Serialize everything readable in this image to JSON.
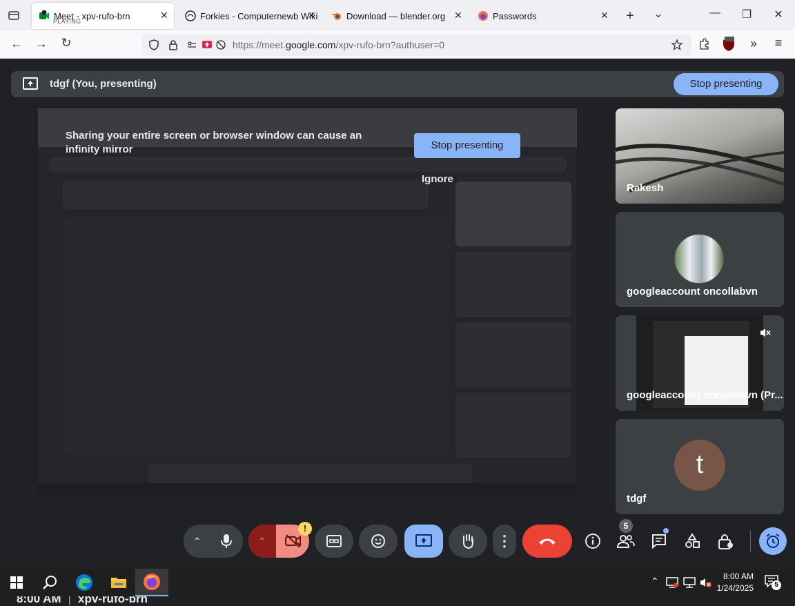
{
  "browser": {
    "tabs": [
      {
        "title": "Meet - xpv-rufo-brn",
        "subtitle": "PLAYING",
        "active": true
      },
      {
        "title": "Forkies - Computernewb Wiki",
        "active": false
      },
      {
        "title": "Download — blender.org",
        "active": false
      },
      {
        "title": "Passwords",
        "active": false
      }
    ],
    "url_prefix": "https://meet.",
    "url_domain": "google.com",
    "url_path": "/xpv-rufo-brn?authuser=0"
  },
  "meet": {
    "presenting_label": "tdgf (You, presenting)",
    "stop_presenting_label": "Stop presenting",
    "warning_text": "Sharing your entire screen or browser window can cause an infinity mirror",
    "warning_stop_label": "Stop presenting",
    "ignore_label": "Ignore",
    "participants": [
      {
        "name": "Rakesh"
      },
      {
        "name": "googleaccount oncollabvn"
      },
      {
        "name": "googleaccount oncollabvn (Pr..."
      },
      {
        "name": "tdgf",
        "initial": "t"
      }
    ],
    "time": "8:00 AM",
    "meeting_code": "xpv-rufo-brn",
    "people_count": "5",
    "alert_badge": "!"
  },
  "taskbar": {
    "time": "8:00 AM",
    "date": "1/24/2025",
    "notifications": "5"
  },
  "colors": {
    "accent": "#8ab4f8",
    "hangup": "#ea4335",
    "tile": "#3c4043",
    "avatar": "#795548"
  }
}
